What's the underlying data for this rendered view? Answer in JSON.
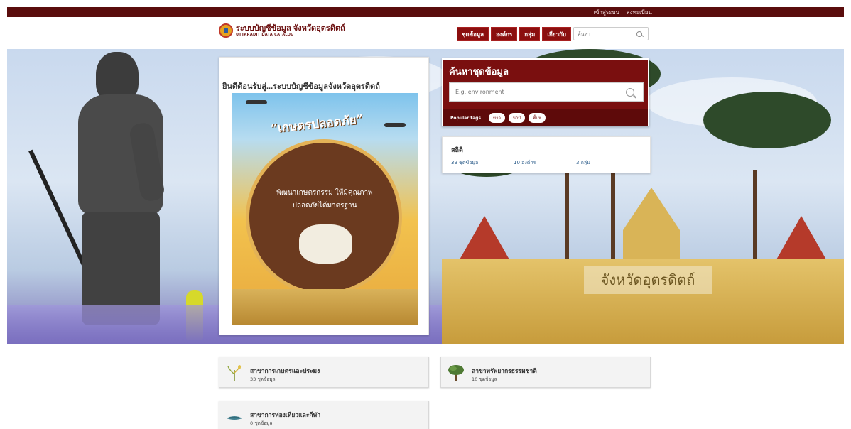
{
  "account": {
    "login": "เข้าสู่ระบบ",
    "register": "ลงทะเบียน"
  },
  "header": {
    "logo_title": "ระบบบัญชีข้อมูล จังหวัดอุตรดิตถ์",
    "logo_subtitle": "UTTARADIT DATA CATALOG",
    "nav": [
      "ชุดข้อมูล",
      "องค์กร",
      "กลุ่ม",
      "เกี่ยวกับ"
    ],
    "search_placeholder": "ค้นหา"
  },
  "hero": {
    "welcome_title": "ยินดีต้อนรับสู่...ระบบบัญชีข้อมูลจังหวัดอุตรดิตถ์",
    "promo_headline": "“เกษตรปลอดภัย”",
    "promo_line1": "พัฒนาเกษตรกรรม ให้มีคุณภาพ",
    "promo_line2": "ปลอดภัยได้มาตรฐาน",
    "gate_sign": "จังหวัดอุตรดิตถ์"
  },
  "search_panel": {
    "title": "ค้นหาชุดข้อมูล",
    "placeholder": "E.g. environment",
    "popular_label": "Popular tags",
    "tags": [
      "ข้าว",
      "นาปี",
      "พื้นที่"
    ]
  },
  "stats": {
    "title": "สถิติ",
    "datasets": "39 ชุดข้อมูล",
    "organizations": "10 องค์กร",
    "groups": "3 กลุ่ม"
  },
  "categories": [
    {
      "title": "สาขาการเกษตรและประมง",
      "count": "33 ชุดข้อมูล",
      "icon": "rice-plant-icon"
    },
    {
      "title": "สาขาทรัพยากรธรรมชาติ",
      "count": "10 ชุดข้อมูล",
      "icon": "tree-icon"
    },
    {
      "title": "สาขาการท่องเที่ยวและกีฬา",
      "count": "0 ชุดข้อมูล",
      "icon": "travel-icon"
    }
  ],
  "colors": {
    "brand": "#7a0f0f",
    "brand_dark": "#5a0d0d",
    "link": "#2b5c8a"
  }
}
